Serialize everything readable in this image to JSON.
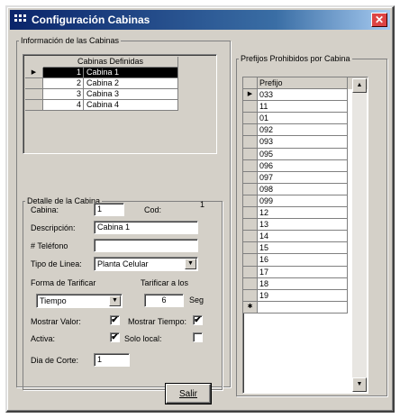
{
  "window": {
    "title": "Configuración Cabinas",
    "close_label": "✕"
  },
  "info_group": {
    "legend": "Información de las Cabinas",
    "grid_header": "Cabinas Definidas",
    "rows": [
      {
        "num": "1",
        "name": "Cabina 1",
        "selected": true
      },
      {
        "num": "2",
        "name": "Cabina 2"
      },
      {
        "num": "3",
        "name": "Cabina 3"
      },
      {
        "num": "4",
        "name": "Cabina 4"
      }
    ]
  },
  "detail_group": {
    "legend": "Detalle de la Cabina",
    "cabina_label": "Cabina:",
    "cabina_value": "1",
    "cod_label": "Cod:",
    "cod_value": "1",
    "descripcion_label": "Descripción:",
    "descripcion_value": "Cabina 1",
    "telefono_label": "# Teléfono",
    "telefono_value": "",
    "tipo_linea_label": "Tipo de Linea:",
    "tipo_linea_value": "Planta Celular",
    "forma_tarificar_label": "Forma de Tarificar",
    "forma_tarificar_value": "Tiempo",
    "tarificar_a_label": "Tarificar a los",
    "tarificar_a_value": "6",
    "seg_label": "Seg",
    "mostrar_valor_label": "Mostrar Valor:",
    "mostrar_valor_checked": "✔",
    "mostrar_tiempo_label": "Mostrar Tiempo:",
    "mostrar_tiempo_checked": "✔",
    "activa_label": "Activa:",
    "activa_checked": "✔",
    "solo_local_label": "Solo local:",
    "solo_local_checked": "",
    "dia_corte_label": "Dia de Corte:",
    "dia_corte_value": "1"
  },
  "prefix_group": {
    "legend": "Prefijos Prohibidos por Cabina",
    "header": "Prefijo",
    "values": [
      "033",
      "11",
      "01",
      "092",
      "093",
      "095",
      "096",
      "097",
      "098",
      "099",
      "12",
      "13",
      "14",
      "15",
      "16",
      "17",
      "18",
      "19",
      ""
    ]
  },
  "salir_button": {
    "label": "Salir"
  }
}
